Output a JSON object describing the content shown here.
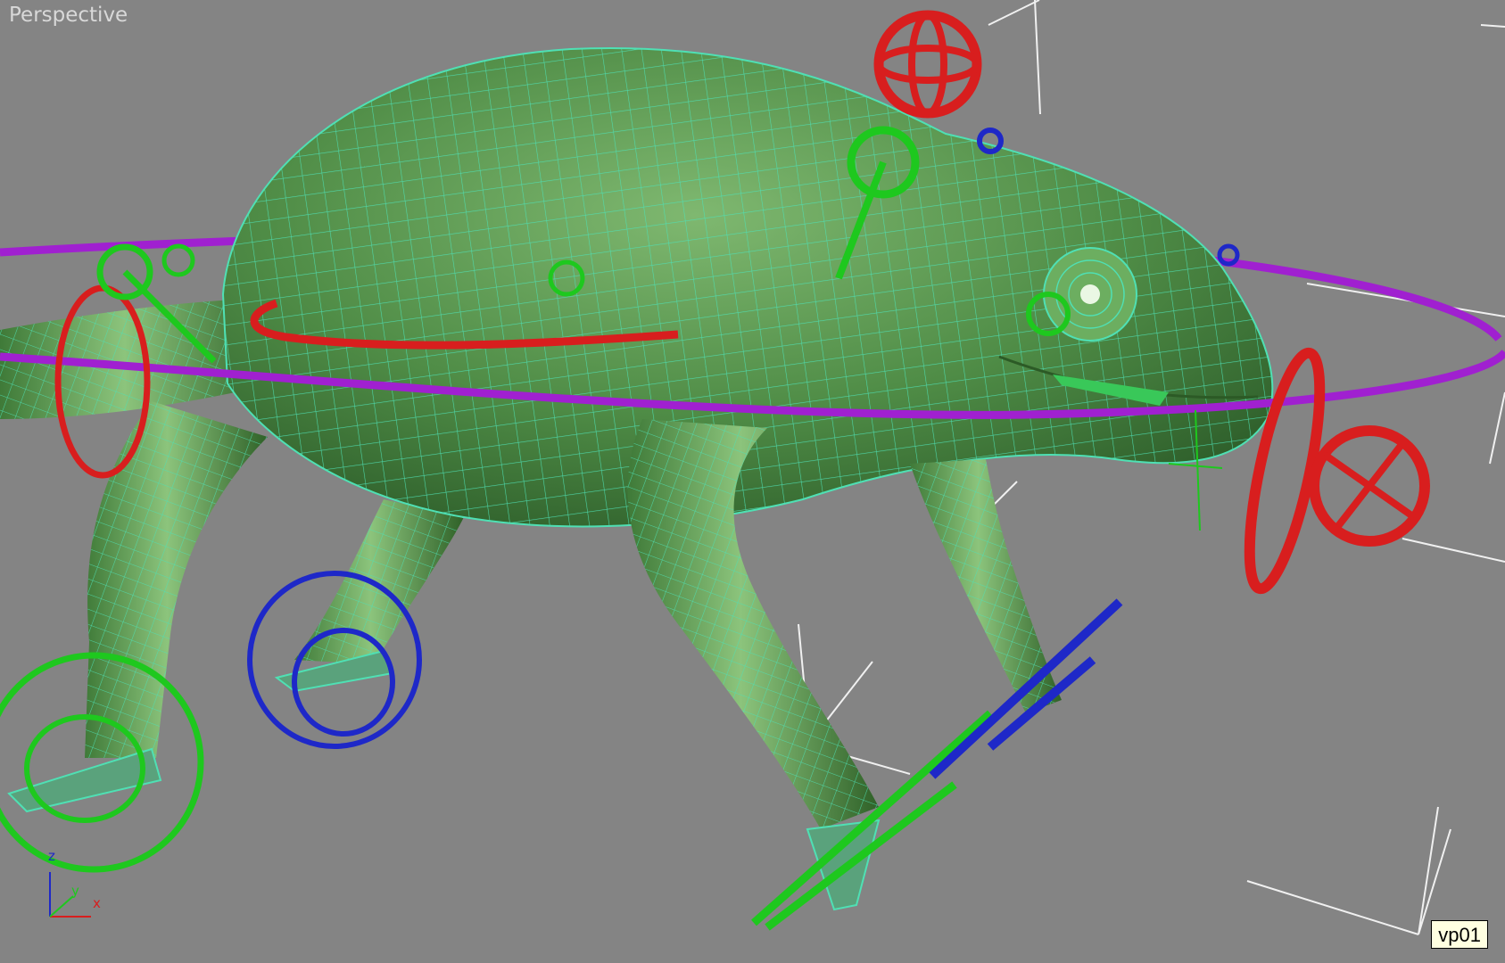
{
  "viewport": {
    "label": "Perspective",
    "camera_badge": "vp01",
    "background": "#848484"
  },
  "axis_tripod": {
    "x": "x",
    "y": "y",
    "z": "z"
  },
  "colors": {
    "mesh": "#5a9a52",
    "wire": "#4fe0b4",
    "control_red": "#d81e1e",
    "control_green": "#1ec81e",
    "control_blue": "#1e28c8",
    "control_purple": "#a020d0",
    "helper_white": "#f0f0f0"
  },
  "scene": {
    "object": "chameleon",
    "display_mode": "smooth + highlights, edged faces"
  }
}
